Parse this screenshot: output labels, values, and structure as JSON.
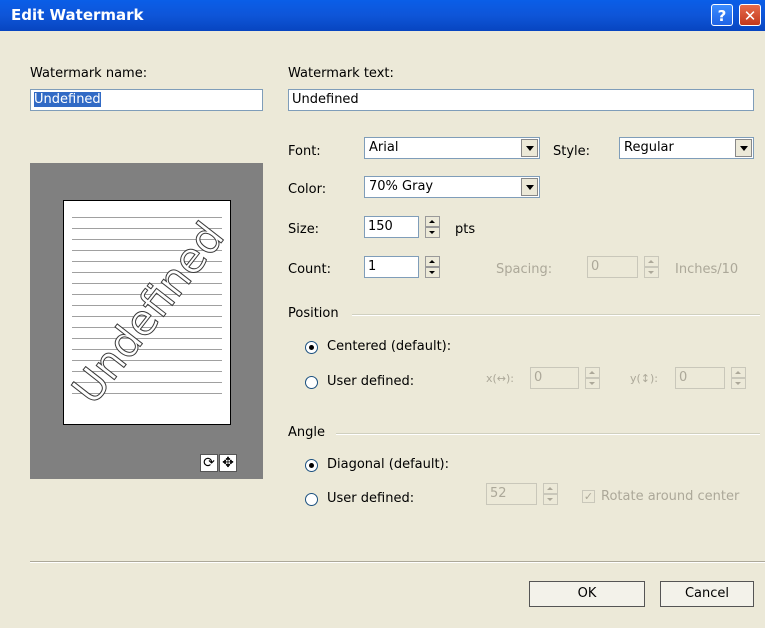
{
  "window": {
    "title": "Edit Watermark",
    "help_label": "?",
    "close_label": "✕"
  },
  "name_field": {
    "label": "Watermark name:",
    "value": "Undefined"
  },
  "text_field": {
    "label": "Watermark text:",
    "value": "Undefined"
  },
  "font": {
    "label": "Font:",
    "value": "Arial"
  },
  "style": {
    "label": "Style:",
    "value": "Regular"
  },
  "color": {
    "label": "Color:",
    "value": "70% Gray"
  },
  "size": {
    "label": "Size:",
    "value": "150",
    "unit": "pts"
  },
  "count": {
    "label": "Count:",
    "value": "1"
  },
  "spacing": {
    "label": "Spacing:",
    "value": "0",
    "unit": "Inches/10"
  },
  "position": {
    "group_label": "Position",
    "centered_label": "Centered (default):",
    "user_label": "User defined:",
    "x_label": "x(↔):",
    "x_value": "0",
    "y_label": "y(↕):",
    "y_value": "0",
    "selected": "centered"
  },
  "angle": {
    "group_label": "Angle",
    "diagonal_label": "Diagonal (default):",
    "user_label": "User defined:",
    "value": "52",
    "rotate_label": "Rotate around center",
    "rotate_checked": true,
    "selected": "diagonal"
  },
  "preview": {
    "watermark_text": "Undefined",
    "rotate_icon": "rotate-icon",
    "move_icon": "move-icon"
  },
  "buttons": {
    "ok": "OK",
    "cancel": "Cancel"
  }
}
